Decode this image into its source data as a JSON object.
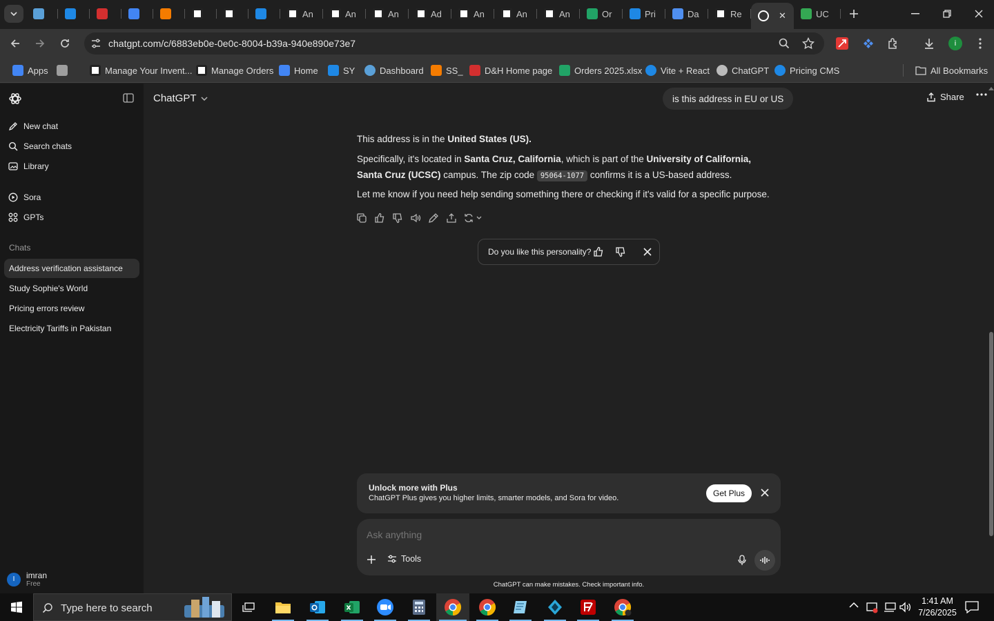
{
  "browser": {
    "tabs": [
      {
        "label": "",
        "icon": "blue-diamond-icon",
        "color": "#5aa0d8"
      },
      {
        "label": "",
        "icon": "ec-icon",
        "color": "#1e88e5"
      },
      {
        "label": "",
        "icon": "dh-icon",
        "color": "#d32f2f"
      },
      {
        "label": "",
        "icon": "google-sites-icon",
        "color": "#4285f4"
      },
      {
        "label": "",
        "icon": "stack-icon",
        "color": "#f57c00"
      },
      {
        "label": "",
        "icon": "amazon-icon",
        "color": "#ffffff"
      },
      {
        "label": "",
        "icon": "amazon-icon",
        "color": "#ffffff"
      },
      {
        "label": "",
        "icon": "dollar-icon",
        "color": "#1e88e5"
      },
      {
        "label": "An",
        "icon": "amazon-icon",
        "color": "#ffffff"
      },
      {
        "label": "An",
        "icon": "amazon-icon",
        "color": "#ffffff"
      },
      {
        "label": "An",
        "icon": "amazon-icon",
        "color": "#ffffff"
      },
      {
        "label": "Ad",
        "icon": "amazon-icon",
        "color": "#ffffff"
      },
      {
        "label": "An",
        "icon": "amazon-icon",
        "color": "#ffffff"
      },
      {
        "label": "An",
        "icon": "amazon-icon",
        "color": "#ffffff"
      },
      {
        "label": "An",
        "icon": "amazon-icon",
        "color": "#ffffff"
      },
      {
        "label": "Or",
        "icon": "excel-icon",
        "color": "#21a366"
      },
      {
        "label": "Pri",
        "icon": "dollar-icon",
        "color": "#1e88e5"
      },
      {
        "label": "Da",
        "icon": "cross-icon",
        "color": "#4f8ff0"
      },
      {
        "label": "Re",
        "icon": "amazon-icon",
        "color": "#ffffff"
      },
      {
        "label": "",
        "icon": "chatgpt-icon",
        "color": "#ffffff",
        "active": true
      },
      {
        "label": "UC",
        "icon": "maps-pin-icon",
        "color": "#34a853"
      }
    ],
    "url": "chatgpt.com/c/6883eb0e-0e0c-8004-b39a-940e890e73e7",
    "bookmarks": [
      {
        "label": "Apps",
        "icon": "apps-grid-icon"
      },
      {
        "label": "",
        "icon": "tab-groups-icon"
      },
      {
        "label": "Manage Your Invent...",
        "icon": "amazon-icon"
      },
      {
        "label": "Manage Orders",
        "icon": "amazon-icon"
      },
      {
        "label": "Home",
        "icon": "google-sites-icon"
      },
      {
        "label": "SY",
        "icon": "ec-icon"
      },
      {
        "label": "Dashboard",
        "icon": "blue-diamond-icon"
      },
      {
        "label": "SS_",
        "icon": "stack-icon"
      },
      {
        "label": "D&H Home page",
        "icon": "dh-icon"
      },
      {
        "label": "Orders 2025.xlsx",
        "icon": "excel-icon"
      },
      {
        "label": "Vite + React",
        "icon": "dollar-icon"
      },
      {
        "label": "ChatGPT",
        "icon": "chatgpt-icon"
      },
      {
        "label": "Pricing CMS",
        "icon": "dollar-icon"
      }
    ],
    "all_bookmarks": "All Bookmarks"
  },
  "sidebar": {
    "new_chat": "New chat",
    "search_chats": "Search chats",
    "library": "Library",
    "sora": "Sora",
    "gpts": "GPTs",
    "chats_heading": "Chats",
    "chats": [
      "Address verification assistance",
      "Study Sophie's World",
      "Pricing errors review",
      "Electricity Tariffs in Pakistan"
    ],
    "user": {
      "initial": "I",
      "name": "imran",
      "plan": "Free"
    }
  },
  "header": {
    "model": "ChatGPT",
    "share": "Share"
  },
  "conversation": {
    "user_message": "is this address in EU or US",
    "p1_pre": "This address is in the ",
    "p1_bold": "United States (US).",
    "p2_pre": "Specifically, it's located in ",
    "p2_bold1": "Santa Cruz, California",
    "p2_mid": ", which is part of the ",
    "p2_bold2": "University of California, Santa Cruz",
    "p2_bold3": "(UCSC)",
    "p2_mid2": " campus. The zip code ",
    "p2_code": "95064-1077",
    "p2_post": " confirms it is a US-based address.",
    "p3": "Let me know if you need help sending something there or checking if it's valid for a specific purpose.",
    "personality_prompt": "Do you like this personality?"
  },
  "upsell": {
    "title": "Unlock more with Plus",
    "subtitle": "ChatGPT Plus gives you higher limits, smarter models, and Sora for video.",
    "button": "Get Plus"
  },
  "composer": {
    "placeholder": "Ask anything",
    "tools": "Tools",
    "disclaimer": "ChatGPT can make mistakes. Check important info."
  },
  "taskbar": {
    "search_placeholder": "Type here to search",
    "time": "1:41 AM",
    "date": "7/26/2025"
  }
}
